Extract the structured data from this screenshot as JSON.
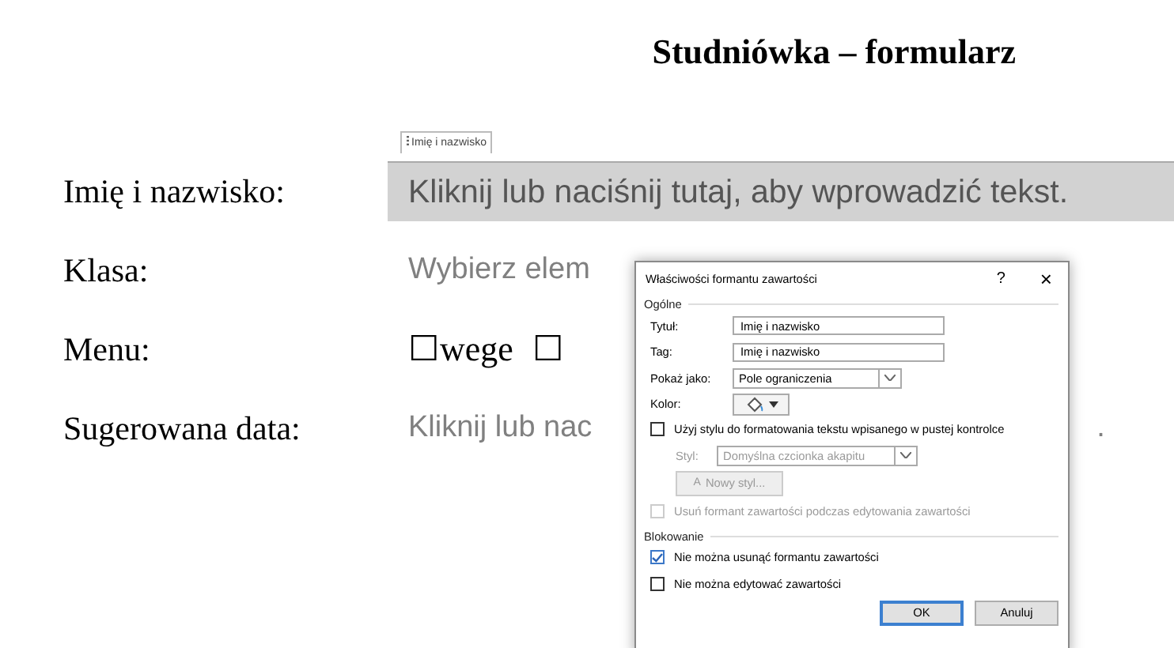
{
  "document": {
    "title": "Studniówka – formularz",
    "rows": [
      {
        "kind": "text",
        "label": "Imię i nazwisko:",
        "tag": "Imię i nazwisko",
        "placeholder": "Kliknij lub naciśnij tutaj, aby wprowadzić tekst.",
        "selected": true
      },
      {
        "kind": "text",
        "label": "Klasa:",
        "placeholder": "Wybierz elem",
        "selected": false
      },
      {
        "kind": "boxes",
        "label": "Menu:",
        "options": [
          {
            "box": "☐",
            "label": "wege"
          },
          {
            "box": "☐"
          }
        ]
      },
      {
        "kind": "text",
        "label": "Sugerowana data:",
        "placeholder": "Kliknij lub nac",
        "placeholder_end": ".",
        "selected": false
      }
    ]
  },
  "dialog": {
    "title": "Właściwości formantu zawartości",
    "help": "?",
    "close": "×",
    "general": {
      "heading": "Ogólne",
      "fields": [
        {
          "kind": "input",
          "label": "Tytuł:",
          "value": "Imię i nazwisko"
        },
        {
          "kind": "input",
          "label": "Tag:",
          "value": "Imię i nazwisko"
        },
        {
          "kind": "combo",
          "label": "Pokaż jako:",
          "value": "Pole ograniczenia",
          "disabled": false
        },
        {
          "kind": "color",
          "label": "Kolor:"
        }
      ],
      "use_style": {
        "label": "Użyj stylu do formatowania tekstu wpisanego w pustej kontrolce",
        "checked": false,
        "disabled": false
      },
      "style": {
        "label": "Styl:",
        "value": "Domyślna czcionka akapitu",
        "disabled": true
      },
      "new_style": {
        "icon": "A",
        "label": "Nowy styl...",
        "disabled": true
      },
      "remove": {
        "label": "Usuń formant zawartości podczas edytowania zawartości",
        "checked": false,
        "disabled": true
      }
    },
    "locking": {
      "heading": "Blokowanie",
      "options": [
        {
          "label": "Nie można usunąć formantu zawartości",
          "checked": true,
          "disabled": false
        },
        {
          "label": "Nie można edytować zawartości",
          "checked": false,
          "disabled": false
        }
      ]
    },
    "buttons": [
      {
        "label": "OK",
        "default": true
      },
      {
        "label": "Anuluj",
        "default": false
      }
    ]
  }
}
